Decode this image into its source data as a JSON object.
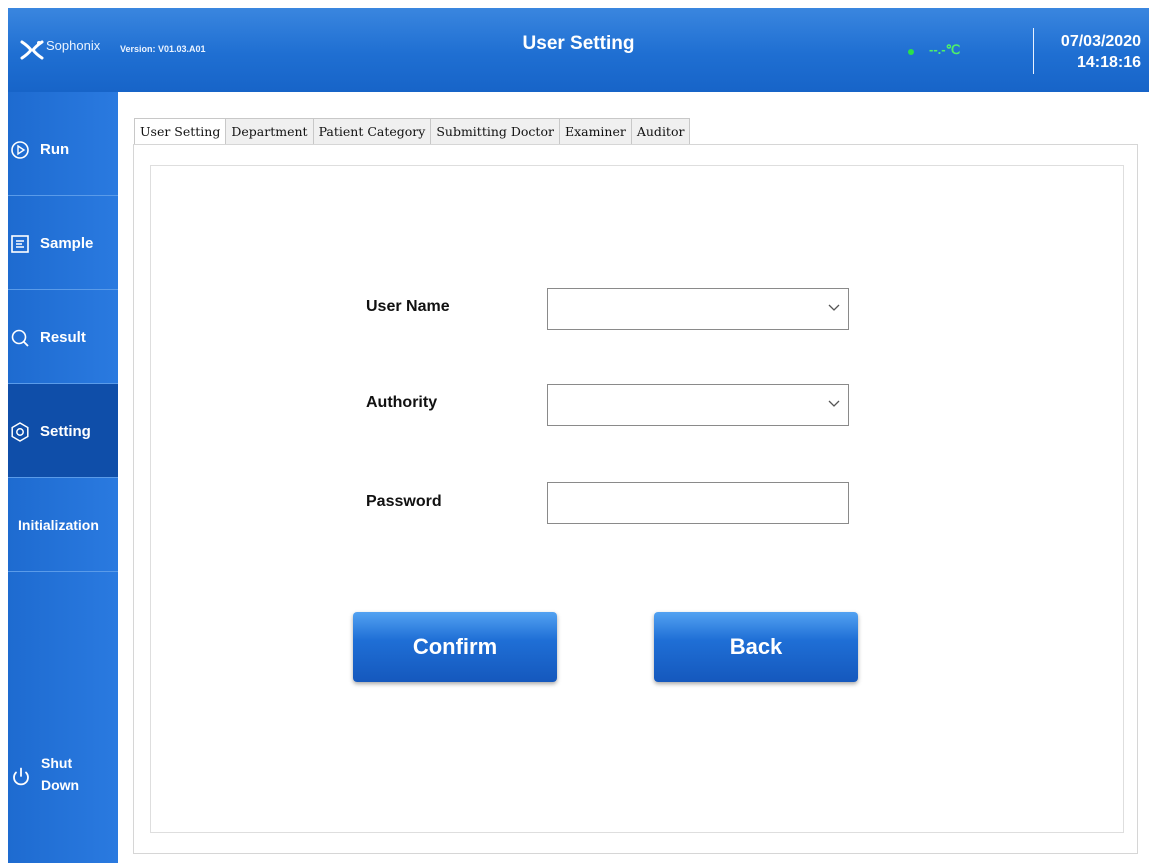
{
  "header": {
    "brand": "Sophonix",
    "version": "Version: V01.03.A01",
    "title": "User Setting",
    "temperature": "--.-℃",
    "date": "07/03/2020",
    "time": "14:18:16",
    "status_dot_color": "#2ae04a"
  },
  "sidebar": {
    "items": [
      {
        "label": "Run",
        "icon": "play-icon"
      },
      {
        "label": "Sample",
        "icon": "list-icon"
      },
      {
        "label": "Result",
        "icon": "search-icon"
      },
      {
        "label": "Setting",
        "icon": "gear-icon",
        "active": true
      },
      {
        "label": "Initialization"
      }
    ],
    "shutdown_line1": "Shut",
    "shutdown_line2": "Down",
    "shutdown_icon": "power-icon"
  },
  "tabs": [
    "User Setting",
    "Department",
    "Patient Category",
    "Submitting Doctor",
    "Examiner",
    "Auditor"
  ],
  "active_tab": "User Setting",
  "form": {
    "user_name_label": "User Name",
    "user_name_value": "",
    "authority_label": "Authority",
    "authority_value": "",
    "password_label": "Password",
    "password_value": ""
  },
  "buttons": {
    "confirm": "Confirm",
    "back": "Back"
  },
  "colors": {
    "header_blue": "#1f6fd2",
    "sidebar_blue": "#2a7ae0",
    "active_nav": "#0f4ea9",
    "button_blue": "#1f6fd6"
  }
}
